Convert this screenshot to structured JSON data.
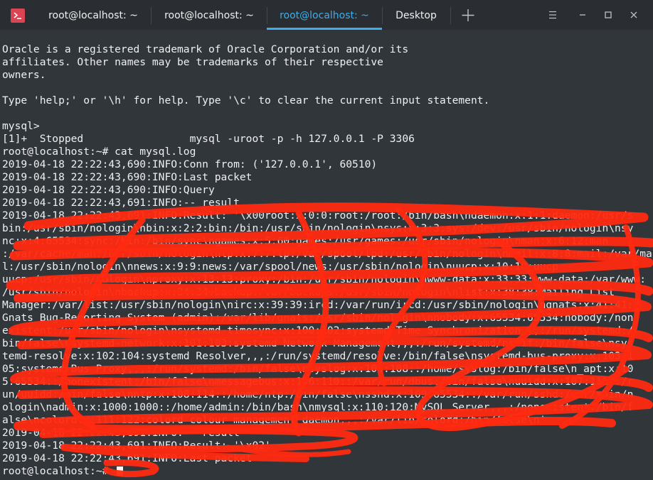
{
  "tabs": [
    {
      "label": "root@localhost: ~",
      "active": false
    },
    {
      "label": "root@localhost: ~",
      "active": false
    },
    {
      "label": "root@localhost: ~",
      "active": true
    },
    {
      "label": "Desktop",
      "active": false
    }
  ],
  "window_controls": [
    "hamburger-menu-icon",
    "minimize-icon",
    "maximize-icon",
    "close-icon"
  ],
  "colors": {
    "accent": "#3daee9",
    "redaction": "#ff2a10",
    "terminal_bg": "#31363b",
    "app_icon": "#da4453"
  },
  "terminal_lines": [
    "",
    "Oracle is a registered trademark of Oracle Corporation and/or its",
    "affiliates. Other names may be trademarks of their respective",
    "owners.",
    "",
    "Type 'help;' or '\\h' for help. Type '\\c' to clear the current input statement.",
    "",
    "mysql>",
    "[1]+  Stopped                 mysql -uroot -p -h 127.0.0.1 -P 3306",
    "root@localhost:~# cat mysql.log",
    "2019-04-18 22:22:43,690:INFO:Conn from: ('127.0.0.1', 60510)",
    "2019-04-18 22:22:43,690:INFO:Last packet",
    "2019-04-18 22:22:43,690:INFO:Query",
    "2019-04-18 22:22:43,691:INFO:-- result",
    "2019-04-18 22:22:43,691:INFO:Result: '\\x00root:x:0:0:root:/root:/bin/bash\\ndaemon:x:1:1:daemon:/usr/s",
    "bin:/usr/sbin/nologin\\nbin:x:2:2:bin:/bin:/usr/sbin/nologin\\nsys:x:3:3:sys:/dev:/usr/sbin/nologin\\nsy",
    "nc:x:4:65534:sync:/bin:/bin/sync\\ngames:x:5:60:games:/usr/games:/usr/sbin/nologin\\nman:x:6:12:man",
    ":/var/cache/man:/usr/sbin/nologin\\nlp:x:7:7:lp:/var/spool/lpd:/usr/sbin/nologin\\nmail:x:8:8:mail:/var/mai",
    "l:/usr/sbin/nologin\\nnews:x:9:9:news:/var/spool/news:/usr/sbin/nologin\\nuucp:x:10:10:uucp",
    "uucp:/usr/sbin/nologin\\nproxy:x:13:13:proxy:/bin:/usr/sbin/nologin\\nwww-data:x:33:33:www-data:/var/www:",
    "/usr/sbin/nologin\\nbackup:x:34:34:backup:/var/backups:/usr/sbin/nologin\\nlist:x:38:38:Mailing List",
    "Manager:/var/list:/usr/sbin/nologin\\nirc:x:39:39:ircd:/var/run/ircd:/usr/sbin/nologin\\ngnats:x:41:41:",
    "Gnats Bug-Reporting System (admin):/var/lib/gnats:/usr/sbin/nologin\\nnobody:x:65534:65534:nobody:/non",
    "existent:/usr/sbin/nologin\\nsystemd-timesync:x:100:102:systemd Time Synchronization,,,:/run/systemd:/",
    "bin/false\\nsystemd-network:x:101:103:systemd Network Management,,,:/run/systemd/netif:/bin/false\\nsys",
    "temd-resolve:x:102:104:systemd Resolver,,,:/run/systemd/resolve:/bin/false\\nsystemd-bus-proxy:x:103:1",
    "05:systemd Bus Proxy,,,:/run/systemd:/bin/false\\nsyslog:x:104:108::/home/syslog:/bin/false\\n_apt:x:10",
    "5:65534::/nonexistent:/bin/false\\nmessagebus:x:106:110::/var/run/dbus:/bin/false\\nuuidd:x:107:111::/r",
    "un/uuidd:/bin/false\\nntp:x:108:114::/home/ntp:/bin/false\\nsshd:x:109:65534::/var/run/sshd:/usr/sbin/n",
    "ologin\\nadmin:x:1000:1000::/home/admin:/bin/bash\\nmysql:x:110:120:MySQL Server,,,:/nonexistent:/bin/f",
    "alse\\ncolord:x:111:122:colord colour management daemon,,,:/var/lib/colord:/bin/false\\n'",
    "2019-04-18 22:22:43,691:INFO:-- result",
    "2019-04-18 22:22:43,691:INFO:Result: '\\x02'",
    "2019-04-18 22:22:43,691:INFO:Last packet",
    "root@localhost:~# "
  ]
}
